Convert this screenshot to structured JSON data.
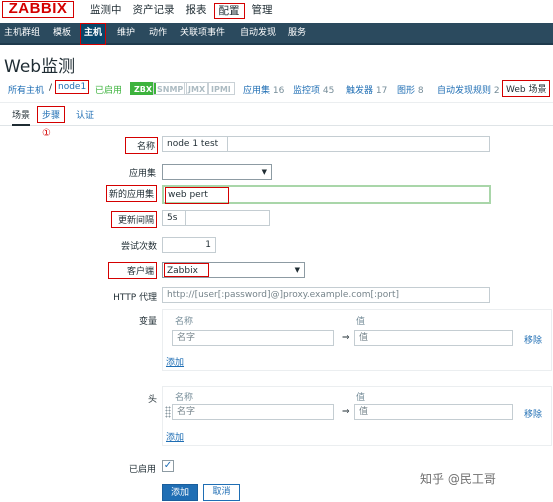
{
  "logo": "ZABBIX",
  "main_menu": [
    "监测中",
    "资产记录",
    "报表",
    "配置",
    "管理"
  ],
  "sub_menu": [
    "主机群组",
    "模板",
    "主机",
    "维护",
    "动作",
    "关联项事件",
    "自动发现",
    "服务"
  ],
  "page_title": "Web监测",
  "nav": {
    "all_hosts": "所有主机",
    "sep": "/",
    "host": "node1",
    "enabled": "已启用",
    "badges": [
      "ZBX",
      "SNMP",
      "JMX",
      "IPMI"
    ],
    "apps": "应用集",
    "apps_count": "16",
    "items": "监控项",
    "items_count": "45",
    "triggers": "触发器",
    "triggers_count": "17",
    "graphs": "图形",
    "graphs_count": "8",
    "discovery": "自动发现规则",
    "discovery_count": "2",
    "web": "Web 场景"
  },
  "tabs": [
    "场景",
    "步骤",
    "认证"
  ],
  "annotation_mark": "①",
  "form": {
    "name_label": "名称",
    "name_value": "node 1 test",
    "application_label": "应用集",
    "new_application_label": "新的应用集",
    "new_application_value": "web pert",
    "interval_label": "更新间隔",
    "interval_value": "5s",
    "attempts_label": "尝试次数",
    "attempts_value": "1",
    "agent_label": "客户端",
    "agent_value": "Zabbix",
    "proxy_label": "HTTP 代理",
    "proxy_placeholder": "http://[user[:password]@]proxy.example.com[:port]",
    "variables_label": "变量",
    "headers_label": "头",
    "col_name": "名称",
    "col_value": "值",
    "name_placeholder": "名字",
    "value_placeholder": "值",
    "arrow": "⇒",
    "remove": "移除",
    "add": "添加",
    "enabled_label": "已启用",
    "check_mark": "✓"
  },
  "buttons": {
    "add": "添加",
    "cancel": "取消"
  },
  "watermark": "知乎 @民工哥",
  "colors": {
    "accent": "#1f6eb4",
    "nav_bar": "#2b4a5e",
    "annotation_red": "#d40000",
    "enabled_green": "#3db33d"
  }
}
